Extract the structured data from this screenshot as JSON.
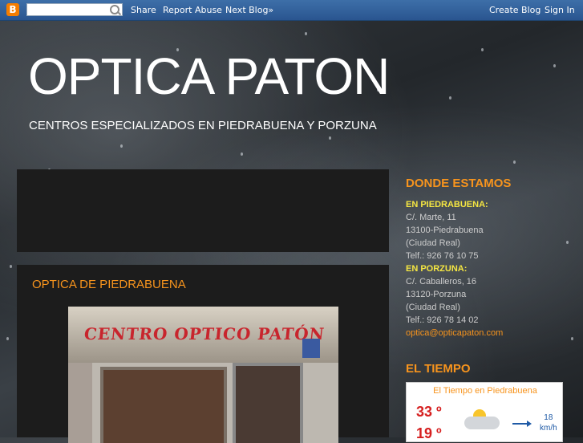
{
  "navbar": {
    "logo_glyph": "B",
    "search_placeholder": "",
    "links": [
      "Share",
      "Report Abuse",
      "Next Blog»"
    ],
    "right_links": [
      "Create Blog",
      "Sign In"
    ]
  },
  "header": {
    "title": "OPTICA PATON",
    "subtitle": "CENTROS ESPECIALIZADOS EN PIEDRABUENA Y PORZUNA"
  },
  "post": {
    "title": "OPTICA DE PIEDRABUENA",
    "photo_sign_text": "CENTRO OPTICO PATÓN"
  },
  "sidebar": {
    "location_heading": "DONDE ESTAMOS",
    "piedrabuena": {
      "label": "EN PIEDRABUENA:",
      "lines": [
        "C/. Marte, 11",
        "13100-Piedrabuena",
        "(Ciudad Real)",
        "Telf.: 926 76 10 75"
      ]
    },
    "porzuna": {
      "label": "EN PORZUNA:",
      "lines": [
        "C/. Caballeros, 16",
        "13120-Porzuna",
        "(Ciudad Real)",
        "Telf.: 926 78 14 02"
      ]
    },
    "email": "optica@opticapaton.com",
    "weather_heading": "EL TIEMPO",
    "weather": {
      "title": "El Tiempo en Piedrabuena",
      "high": "33 º",
      "low": "19 º",
      "wind_speed": "18",
      "wind_unit": "km/h"
    }
  }
}
